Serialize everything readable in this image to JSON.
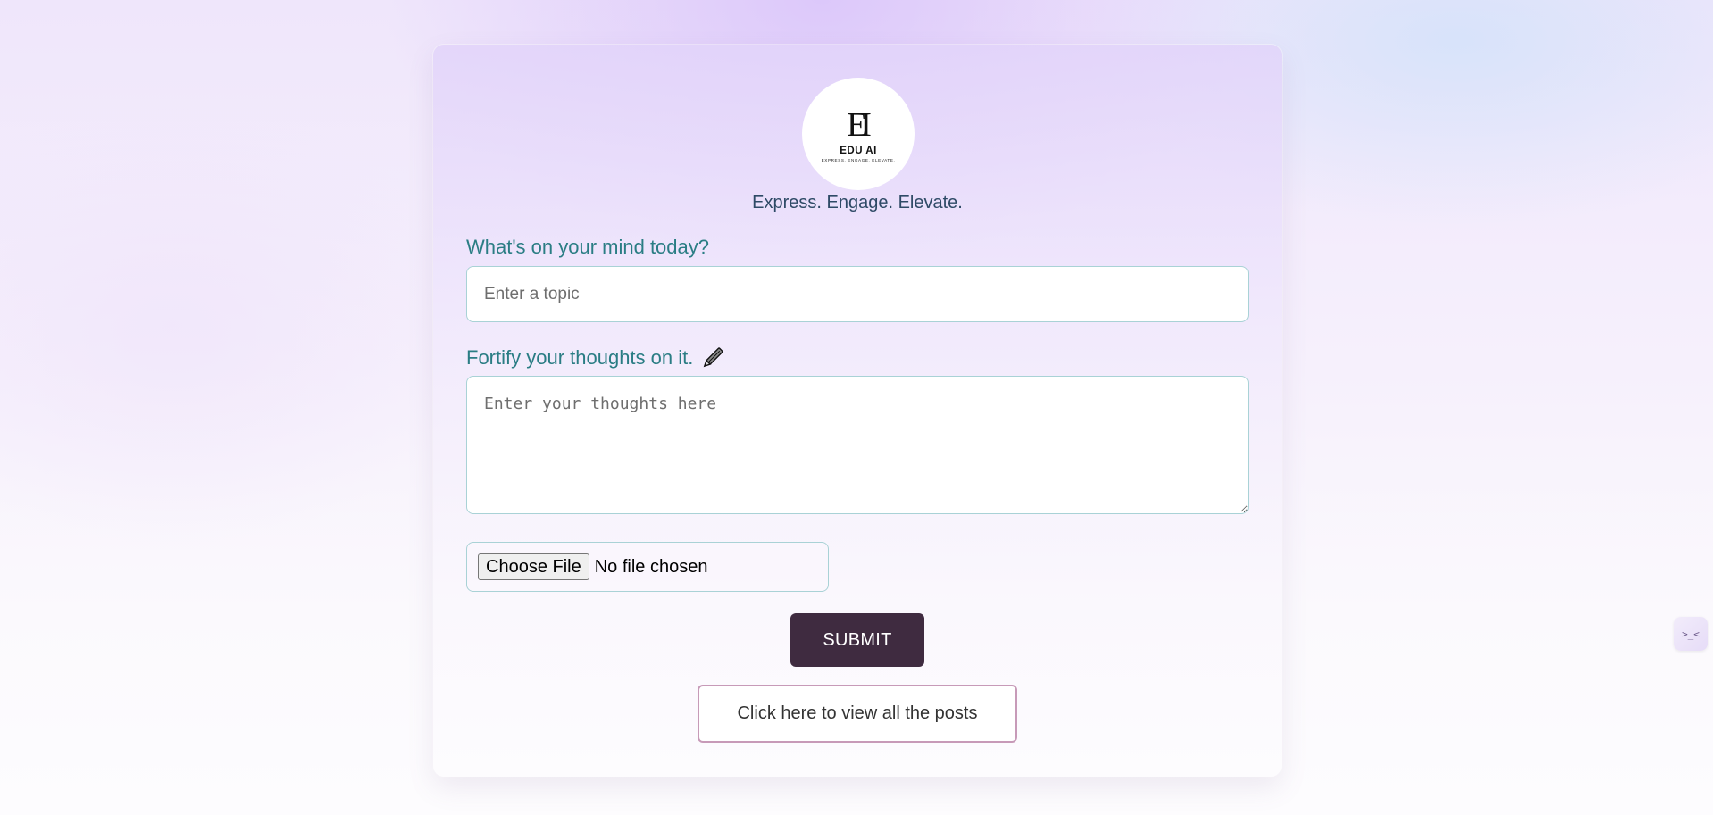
{
  "logo": {
    "mark": "EI",
    "name": "EDU AI",
    "sub": "EXPRESS. ENGAGE. ELEVATE."
  },
  "tagline": "Express. Engage. Elevate.",
  "topic": {
    "label": "What's on your mind today?",
    "placeholder": "Enter a topic",
    "value": ""
  },
  "thoughts": {
    "label": "Fortify your thoughts on it.",
    "icon": "pencil-icon",
    "placeholder": "Enter your thoughts here",
    "value": ""
  },
  "file": {
    "button_label": "Choose File",
    "status": "No file chosen"
  },
  "actions": {
    "submit_label": "SUBMIT",
    "view_posts_label": "Click here to view all the posts"
  },
  "side_widget": {
    "glyph": ">_<",
    "icon": "extension-icon"
  },
  "colors": {
    "accent_label": "#2a7d84",
    "submit_bg": "#3f2b40",
    "posts_border": "#c79ab8",
    "input_border": "#a9d2d6"
  }
}
